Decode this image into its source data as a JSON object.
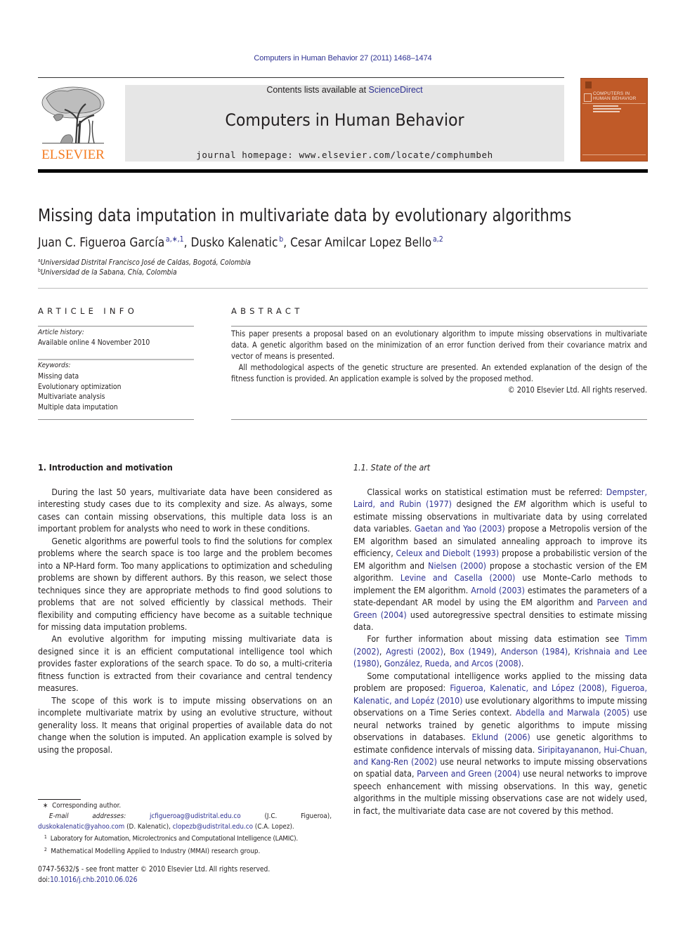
{
  "header": {
    "running_head": "Computers in Human Behavior 27 (2011) 1468–1474",
    "contents_prefix": "Contents lists available at ",
    "contents_link": "ScienceDirect",
    "journal_title": "Computers in Human Behavior",
    "homepage": "journal homepage: www.elsevier.com/locate/comphumbeh",
    "publisher_logo_text": "ELSEVIER",
    "cover_title_line1": "COMPUTERS IN",
    "cover_title_line2": "HUMAN BEHAVIOR",
    "colors": {
      "link": "#2e3192",
      "elsevier_orange": "#f47b20",
      "cover": "#c05a28",
      "banner": "#e6e6e6"
    }
  },
  "article": {
    "title": "Missing data imputation in multivariate data by evolutionary algorithms",
    "authors": [
      {
        "name": "Juan C. Figueroa García",
        "marks": "a,∗,1",
        "sep": ", "
      },
      {
        "name": "Dusko Kalenatic",
        "marks": "b",
        "sep": ", "
      },
      {
        "name": "Cesar Amilcar Lopez Bello",
        "marks": "a,2",
        "sep": ""
      }
    ],
    "affiliations": [
      {
        "mark": "a",
        "text": "Universidad Distrital Francisco José de Caldas, Bogotá, Colombia"
      },
      {
        "mark": "b",
        "text": "Universidad de la Sabana, Chía, Colombia"
      }
    ]
  },
  "article_info": {
    "heading": "ARTICLE INFO",
    "history_label": "Article history:",
    "history_value": "Available online 4 November 2010",
    "keywords_label": "Keywords:",
    "keywords": [
      "Missing data",
      "Evolutionary optimization",
      "Multivariate analysis",
      "Multiple data imputation"
    ]
  },
  "abstract": {
    "heading": "ABSTRACT",
    "paragraph1": "This paper presents a proposal based on an evolutionary algorithm to impute missing observations in multivariate data. A genetic algorithm based on the minimization of an error function derived from their covariance matrix and vector of means is presented.",
    "paragraph2": "All methodological aspects of the genetic structure are presented. An extended explanation of the design of the fitness function is provided. An application example is solved by the proposed method.",
    "copyright": "© 2010 Elsevier Ltd. All rights reserved."
  },
  "section1": {
    "heading": "1. Introduction and motivation",
    "paragraphs": [
      "During the last 50 years, multivariate data have been considered as interesting study cases due to its complexity and size. As always, some cases can contain missing observations, this multiple data loss is an important problem for analysts who need to work in these conditions.",
      "Genetic algorithms are powerful tools to find the solutions for complex problems where the search space is too large and the problem becomes into a NP-Hard form. Too many applications to optimization and scheduling problems are shown by different authors. By this reason, we select those techniques since they are appropriate methods to find good solutions to problems that are not solved efficiently by classical methods. Their flexibility and computing efficiency have become as a suitable technique for missing data imputation problems.",
      "An evolutive algorithm for imputing missing multivariate data is designed since it is an efficient computational intelligence tool which provides faster explorations of the search space. To do so, a multi-criteria fitness function is extracted from their covariance and central tendency measures.",
      "The scope of this work is to impute missing observations on an incomplete multivariate matrix by using an evolutive structure, without generality loss. It means that original properties of available data do not change when the solution is imputed. An application example is solved by using the proposal."
    ]
  },
  "section1_1": {
    "heading": "1.1. State of the art",
    "p1": {
      "t1": "Classical works on statistical estimation must be referred: ",
      "l1": "Dempster, Laird, and Rubin (1977)",
      "t2": " designed the ",
      "em": "EM",
      "t3": " algorithm which is useful to estimate missing observations in multivariate data by using correlated data variables. ",
      "l2": "Gaetan and Yao (2003)",
      "t4": " propose a Metropolis version of the EM algorithm based an simulated annealing approach to improve its efficiency, ",
      "l3": "Celeux and Diebolt (1993)",
      "t5": " propose a probabilistic version of the EM algorithm and ",
      "l4": "Nielsen (2000)",
      "t6": " propose a stochastic version of the EM algorithm. ",
      "l5": "Levine and Casella (2000)",
      "t7": " use Monte–Carlo methods to implement the EM algorithm. ",
      "l6": "Arnold (2003)",
      "t8": " estimates the parameters of a state-dependant AR model by using the EM algorithm and ",
      "l7": "Parveen and Green (2004)",
      "t9": " used autoregressive spectral densities to estimate missing data."
    },
    "p2": {
      "t1": "For further information about missing data estimation see ",
      "l1": "Timm (2002)",
      "l2": "Agresti (2002)",
      "l3": "Box (1949)",
      "l4": "Anderson (1984)",
      "l5": "Krishnaia and Lee (1980)",
      "l6": "González, Rueda, and Arcos (2008)",
      "sep": ", ",
      "end": "."
    },
    "p3": {
      "t1": "Some computational intelligence works applied to the missing data problem are proposed: ",
      "l1": "Figueroa, Kalenatic, and López (2008)",
      "l2": "Figueroa, Kalenatic, and Lopéz (2010)",
      "t2": " use evolutionary algorithms to impute missing observations on a Time Series context. ",
      "l3": "Abdella and Marwala (2005)",
      "t3": " use neural networks trained by genetic algorithms to impute missing observations in databases. ",
      "l4": "Eklund (2006)",
      "t4": " use genetic algorithms to estimate confidence intervals of missing data. ",
      "l5": "Siripitayananon, Hui-Chuan, and Kang-Ren (2002)",
      "t5": " use neural networks to impute missing observations on spatial data, ",
      "l6": "Parveen and Green (2004)",
      "t6": " use neural networks to improve speech enhancement with missing observations. In this way, genetic algorithms in the multiple missing observations case are not widely used, in fact, the multivariate data case are not covered by this method."
    }
  },
  "footnotes": {
    "corresponding_mark": "∗",
    "corresponding_text": "Corresponding author.",
    "email_label": "E-mail addresses:",
    "emails": [
      {
        "address": "jcfigueroag@udistrital.edu.co",
        "who": "(J.C. Figueroa)"
      },
      {
        "address": "duskokalenatic@yahoo.com",
        "who": "(D. Kalenatic)"
      },
      {
        "address": "clopezb@udistrital.edu.co",
        "who": "(C.A. Lopez)."
      }
    ],
    "notes": [
      {
        "mark": "1",
        "text": "Laboratory for Automation, Microlectronics and Computational Intelligence (LAMIC)."
      },
      {
        "mark": "2",
        "text": "Mathematical Modelling Applied to Industry (MMAI) research group."
      }
    ]
  },
  "bottom": {
    "issn_line": "0747-5632/$ - see front matter © 2010 Elsevier Ltd. All rights reserved.",
    "doi_prefix": "doi:",
    "doi": "10.1016/j.chb.2010.06.026"
  }
}
